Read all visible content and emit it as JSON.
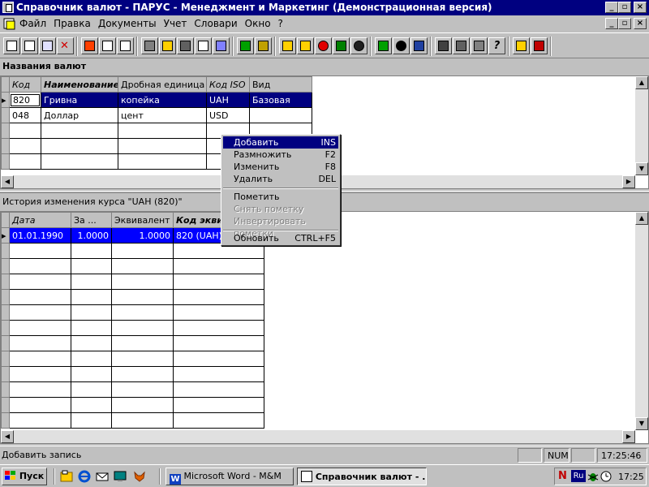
{
  "window": {
    "title": "Справочник валют - ПАРУС - Менеджмент и Маркетинг (Демонстрационная версия)",
    "min": "_",
    "max": "▫",
    "close": "×"
  },
  "menu": [
    "Файл",
    "Правка",
    "Документы",
    "Учет",
    "Словари",
    "Окно",
    "?"
  ],
  "toolbar_icons": [
    "new-doc-icon",
    "copy-doc-icon",
    "edit-doc-icon",
    "delete-icon",
    "move-right-icon",
    "move-icon",
    "move-left-icon",
    "filter-icon",
    "find-icon",
    "print-icon",
    "print-preview-icon",
    "link-icon",
    "transfer-icon",
    "export-icon",
    "import-icon",
    "refresh-icon",
    "clock-icon",
    "pointer-icon",
    "bomb-icon",
    "report-icon",
    "yin-yang-icon",
    "wizard-icon",
    "user-icon",
    "tools-icon",
    "calculator-icon",
    "help-icon",
    "scroll-icon",
    "exit-icon"
  ],
  "top_panel": {
    "title": "Названия валют",
    "columns": [
      "Код",
      "Наименование",
      "Дробная единица",
      "Код ISO",
      "Вид"
    ],
    "rows": [
      [
        "820",
        "Гривна",
        "копейка",
        "UAH",
        "Базовая"
      ],
      [
        "048",
        "Доллар",
        "цент",
        "USD",
        ""
      ]
    ]
  },
  "bottom_panel": {
    "title": "История изменения курса \"UAH (820)\"",
    "columns": [
      "Дата",
      "За ...",
      "Эквивалент",
      "Код эквивалента"
    ],
    "rows": [
      [
        "01.01.1990",
        "1.0000",
        "1.0000",
        "820  (UAH)"
      ]
    ]
  },
  "context_menu": [
    {
      "label": "Добавить",
      "key": "INS",
      "state": "highlighted"
    },
    {
      "label": "Размножить",
      "key": "F2",
      "state": "normal"
    },
    {
      "label": "Изменить",
      "key": "F8",
      "state": "normal"
    },
    {
      "label": "Удалить",
      "key": "DEL",
      "state": "normal"
    },
    {
      "label": "Пометить",
      "key": "",
      "state": "normal"
    },
    {
      "label": "Снять пометку",
      "key": "",
      "state": "disabled"
    },
    {
      "label": "Инвертировать пометки",
      "key": "",
      "state": "disabled"
    },
    {
      "label": "Обновить",
      "key": "CTRL+F5",
      "state": "normal"
    }
  ],
  "status": {
    "message": "Добавить запись",
    "num": "NUM",
    "time": "17:25:46"
  },
  "taskbar": {
    "start": "Пуск",
    "buttons": [
      {
        "label": "Microsoft Word - M&M",
        "active": false
      },
      {
        "label": "Справочник валют - ...",
        "active": true
      }
    ],
    "tray_lang": "Ru",
    "clock": "17:25"
  },
  "colors": {
    "title_bar": "#000080",
    "selection": "#000080",
    "selection_bottom": "#0000ff"
  }
}
